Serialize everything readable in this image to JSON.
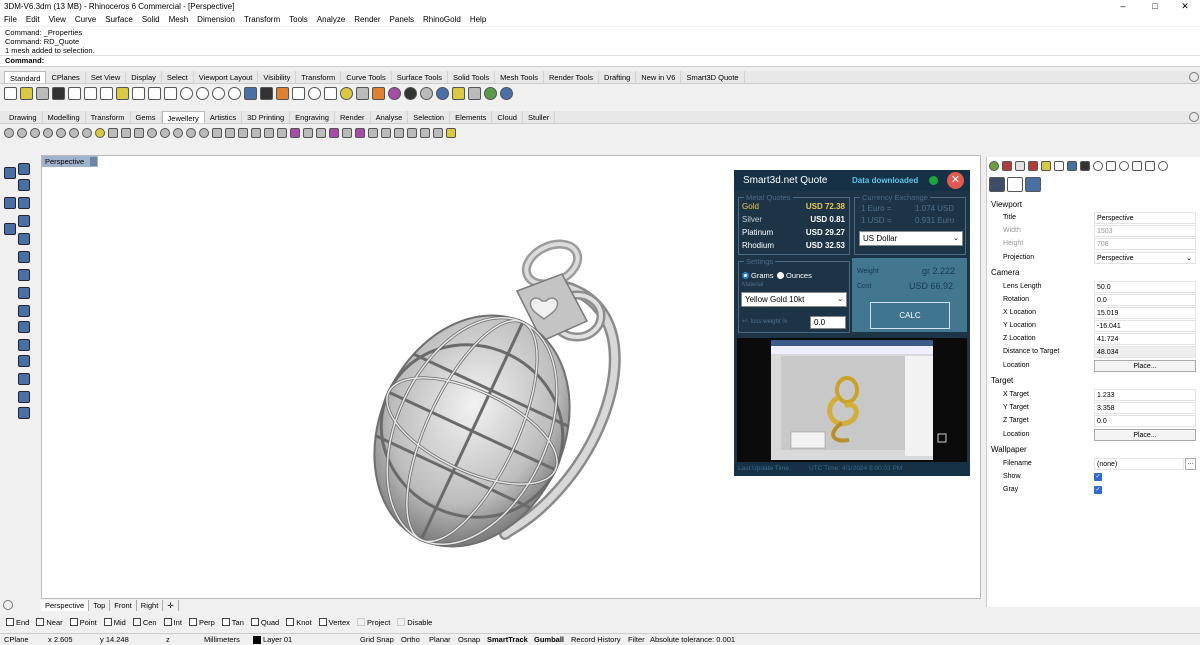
{
  "window": {
    "title": "3DM-V6.3dm (13 MB) - Rhinoceros 6 Commercial - [Perspective]",
    "min": "–",
    "max": "□",
    "close": "✕"
  },
  "menu": [
    "File",
    "Edit",
    "View",
    "Curve",
    "Surface",
    "Solid",
    "Mesh",
    "Dimension",
    "Transform",
    "Tools",
    "Analyze",
    "Render",
    "Panels",
    "RhinoGold",
    "Help"
  ],
  "command_history": [
    "Command: _Properties",
    "Command: RD_Quote",
    "1 mesh added to selection."
  ],
  "command_prompt": "Command:",
  "tabs1": [
    "Standard",
    "CPlanes",
    "Set View",
    "Display",
    "Select",
    "Viewport Layout",
    "Visibility",
    "Transform",
    "Curve Tools",
    "Surface Tools",
    "Solid Tools",
    "Mesh Tools",
    "Render Tools",
    "Drafting",
    "New in V6",
    "Smart3D Quote"
  ],
  "tabs2": [
    "Drawing",
    "Modelling",
    "Transform",
    "Gems",
    "Jewellery",
    "Artistics",
    "3D Printing",
    "Engraving",
    "Render",
    "Analyse",
    "Selection",
    "Elements",
    "Cloud",
    "Stuller"
  ],
  "viewport": {
    "label": "Perspective"
  },
  "properties": {
    "sections": {
      "viewport": "Viewport",
      "camera": "Camera",
      "target": "Target",
      "wallpaper": "Wallpaper"
    },
    "title_k": "Title",
    "title_v": "Perspective",
    "width_k": "Width",
    "width_v": "1503",
    "height_k": "Height",
    "height_v": "708",
    "projection_k": "Projection",
    "projection_v": "Perspective",
    "lens_k": "Lens Length",
    "lens_v": "50.0",
    "rotation_k": "Rotation",
    "rotation_v": "0.0",
    "xloc_k": "X Location",
    "xloc_v": "15.019",
    "yloc_k": "Y Location",
    "yloc_v": "-16.041",
    "zloc_k": "Z Location",
    "zloc_v": "41.724",
    "dist_k": "Distance to Target",
    "dist_v": "48.034",
    "loc_k": "Location",
    "place": "Place...",
    "xt_k": "X Target",
    "xt_v": "1.233",
    "yt_k": "Y Target",
    "yt_v": "3.358",
    "zt_k": "Z Target",
    "zt_v": "0.0",
    "tloc_k": "Location",
    "file_k": "Filename",
    "file_v": "(none)",
    "show_k": "Show",
    "gray_k": "Gray"
  },
  "quote": {
    "logo": "Smart3d.net Quote",
    "status": "Data downloaded",
    "metal_title": "Metal Quotes",
    "metals": [
      {
        "name": "Gold",
        "value": "USD 72.38"
      },
      {
        "name": "Silver",
        "value": "USD 0.81"
      },
      {
        "name": "Platinum",
        "value": "USD 29.27"
      },
      {
        "name": "Rhodium",
        "value": "USD 32.53"
      }
    ],
    "currency_title": "Currency Exchange",
    "fx1_l": "1 Euro =",
    "fx1_v": "1.074 USD",
    "fx2_l": "1 USD =",
    "fx2_v": "0.931 Euro",
    "currency": "US Dollar",
    "settings_title": "Settings",
    "grams": "Grams",
    "ounces": "Ounces",
    "material_label": "Material",
    "material": "Yellow Gold 10kt",
    "loss_label": "+/- loss weight %",
    "loss": "0.0",
    "weight_label": "Weight",
    "weight_value": "gr 2.222",
    "cost_label": "Cost",
    "cost_value": "USD 66.92",
    "calc": "CALC",
    "footer_l": "Last Update Time",
    "footer_r": "UTC Time: 4/1/2024 9:00:03 PM"
  },
  "bottom_tabs": [
    "Perspective",
    "Top",
    "Front",
    "Right"
  ],
  "osnaps": [
    "End",
    "Near",
    "Point",
    "Mid",
    "Cen",
    "Int",
    "Perp",
    "Tan",
    "Quad",
    "Knot",
    "Vertex",
    "Project",
    "Disable"
  ],
  "status": {
    "cplane": "CPlane",
    "x": "x 2.605",
    "y": "y 14.248",
    "z": "z",
    "units": "Millimeters",
    "layer": "Layer 01",
    "gridsnap": "Grid Snap",
    "ortho": "Ortho",
    "planar": "Planar",
    "osnap": "Osnap",
    "smarttrack": "SmartTrack",
    "gumball": "Gumball",
    "history": "Record History",
    "filter": "Filter",
    "tolerance": "Absolute tolerance: 0.001"
  }
}
